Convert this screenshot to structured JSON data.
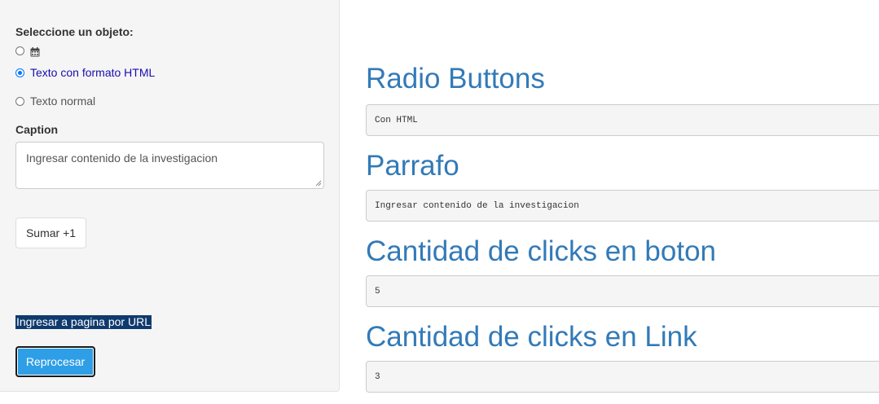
{
  "sidebar": {
    "select_label": "Seleccione un objeto:",
    "radio_options": [
      {
        "label": "",
        "icon": "calendar-icon",
        "checked": false
      },
      {
        "label": "Texto con formato HTML",
        "checked": true
      },
      {
        "label": "Texto normal",
        "checked": false
      }
    ],
    "caption_label": "Caption",
    "caption_value": "Ingresar contenido de la investigacion",
    "sum_button": "Sumar +1",
    "url_link": "Ingresar a pagina por URL",
    "reprocess_button": "Reprocesar"
  },
  "main": {
    "sections": [
      {
        "title": "Radio Buttons",
        "output": "Con HTML"
      },
      {
        "title": "Parrafo",
        "output": "Ingresar contenido de la investigacion"
      },
      {
        "title": "Cantidad de clicks en boton",
        "output": "5"
      },
      {
        "title": "Cantidad de clicks en Link",
        "output": "3"
      }
    ]
  },
  "colors": {
    "heading": "#337ab7",
    "radio_selected_text": "#1a0dab",
    "primary_button": "#2e9fe6",
    "link_highlight": "#0f3a6e"
  }
}
